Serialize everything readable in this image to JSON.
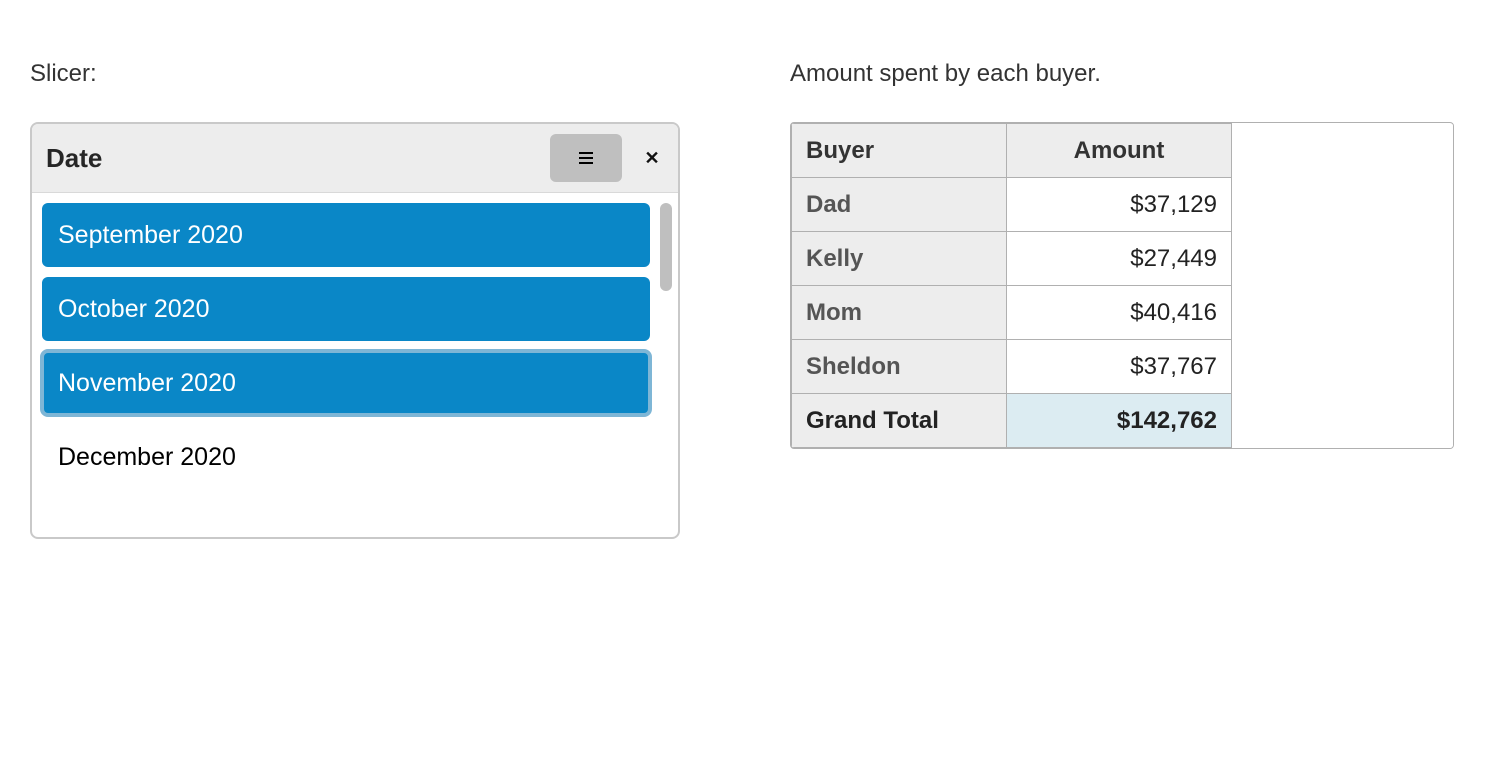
{
  "slicer": {
    "label": "Slicer:",
    "title": "Date",
    "items": [
      {
        "label": "September 2020",
        "selected": true,
        "focused": false
      },
      {
        "label": "October 2020",
        "selected": true,
        "focused": false
      },
      {
        "label": "November 2020",
        "selected": true,
        "focused": true
      },
      {
        "label": "December 2020",
        "selected": false,
        "focused": false
      }
    ],
    "icons": {
      "menu": "menu-icon",
      "close": "✕"
    }
  },
  "pivot": {
    "label": "Amount spent by each buyer.",
    "headers": {
      "buyer": "Buyer",
      "amount": "Amount"
    },
    "rows": [
      {
        "buyer": "Dad",
        "amount": "$37,129"
      },
      {
        "buyer": "Kelly",
        "amount": "$27,449"
      },
      {
        "buyer": "Mom",
        "amount": "$40,416"
      },
      {
        "buyer": "Sheldon",
        "amount": "$37,767"
      }
    ],
    "total": {
      "label": "Grand Total",
      "amount": "$142,762"
    }
  },
  "chart_data": {
    "type": "table",
    "title": "Amount spent by each buyer.",
    "columns": [
      "Buyer",
      "Amount"
    ],
    "rows": [
      [
        "Dad",
        37129
      ],
      [
        "Kelly",
        27449
      ],
      [
        "Mom",
        40416
      ],
      [
        "Sheldon",
        37767
      ]
    ],
    "grand_total": 142762,
    "filter": {
      "field": "Date",
      "selected": [
        "September 2020",
        "October 2020",
        "November 2020"
      ]
    }
  }
}
